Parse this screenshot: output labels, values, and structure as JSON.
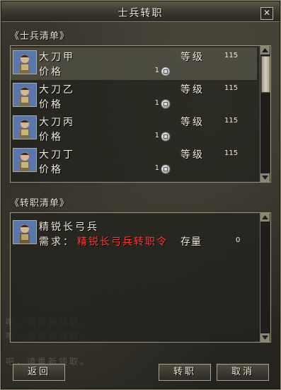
{
  "window": {
    "title": "士兵转职",
    "close_glyph": "✕"
  },
  "soldier_list": {
    "header": "《士兵清单》",
    "items": [
      {
        "name": "大刀甲",
        "price_label": "价格",
        "price": "1",
        "level_label": "等级",
        "level": "115",
        "selected": true
      },
      {
        "name": "大刀乙",
        "price_label": "价格",
        "price": "1",
        "level_label": "等级",
        "level": "115",
        "selected": false
      },
      {
        "name": "大刀丙",
        "price_label": "价格",
        "price": "1",
        "level_label": "等级",
        "level": "115",
        "selected": false
      },
      {
        "name": "大刀丁",
        "price_label": "价格",
        "price": "1",
        "level_label": "等级",
        "level": "115",
        "selected": false
      }
    ]
  },
  "promotion_list": {
    "header": "《转职清单》",
    "items": [
      {
        "name": "精锐长弓兵",
        "require_label": "需求：",
        "require_item": "精锐长弓兵转职令",
        "stock_label": "存量",
        "stock": "0"
      }
    ]
  },
  "buttons": {
    "back": "返回",
    "promote": "转职",
    "cancel": "取消"
  },
  "colors": {
    "requirement_text": "#ff3b3b",
    "selected_row": "#8d8975"
  },
  "icons": {
    "coin": "silver-coin-icon",
    "portrait": "soldier-portrait-icon",
    "scroll_up": "arrow-up-icon",
    "scroll_down": "arrow-down-icon"
  }
}
